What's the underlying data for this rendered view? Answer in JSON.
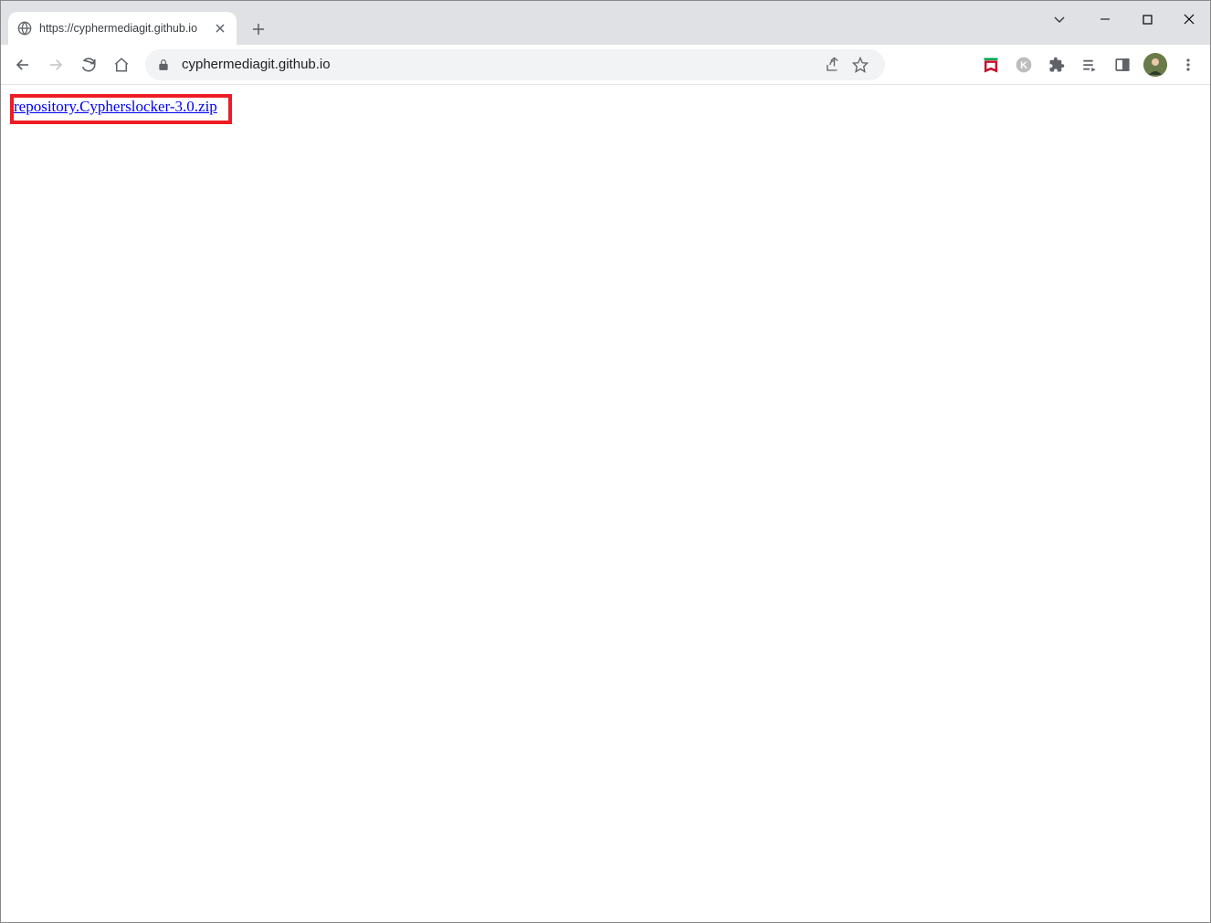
{
  "browser": {
    "tab_title": "https://cyphermediagit.github.io",
    "url_display": "cyphermediagit.github.io"
  },
  "page": {
    "link_text": "repository.Cypherslocker-3.0.zip"
  }
}
